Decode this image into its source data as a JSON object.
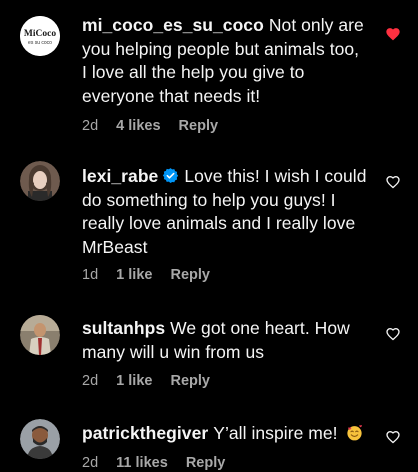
{
  "comments": [
    {
      "username": "mi_coco_es_su_coco",
      "text": "Not only are you helping people but animals too, I love all the help you give to everyone that needs it!",
      "time": "2d",
      "likes": "4 likes",
      "reply": "Reply",
      "verified": false,
      "liked": true,
      "avatar_text_1": "MiCoco",
      "avatar_text_2": "es su coco"
    },
    {
      "username": "lexi_rabe",
      "text": "Love this! I wish I could do something to help you guys! I really love animals and I really love MrBeast",
      "time": "1d",
      "likes": "1 like",
      "reply": "Reply",
      "verified": true,
      "liked": false
    },
    {
      "username": "sultanhps",
      "text": "We got one heart. How many will u win from us",
      "time": "2d",
      "likes": "1 like",
      "reply": "Reply",
      "verified": false,
      "liked": false
    },
    {
      "username": "patrickthegiver",
      "text": "Y’all inspire me!",
      "emoji": "smiling-face-with-hearts-emoji",
      "time": "2d",
      "likes": "11 likes",
      "reply": "Reply",
      "verified": false,
      "liked": false
    }
  ],
  "colors": {
    "background": "#000000",
    "text": "#f5f5f5",
    "secondary": "#a8a8a8",
    "liked_heart": "#ff3040",
    "verified": "#0095f6"
  },
  "icons": {
    "like": "heart-icon",
    "liked": "heart-filled-icon",
    "verified": "verified-badge-icon"
  }
}
